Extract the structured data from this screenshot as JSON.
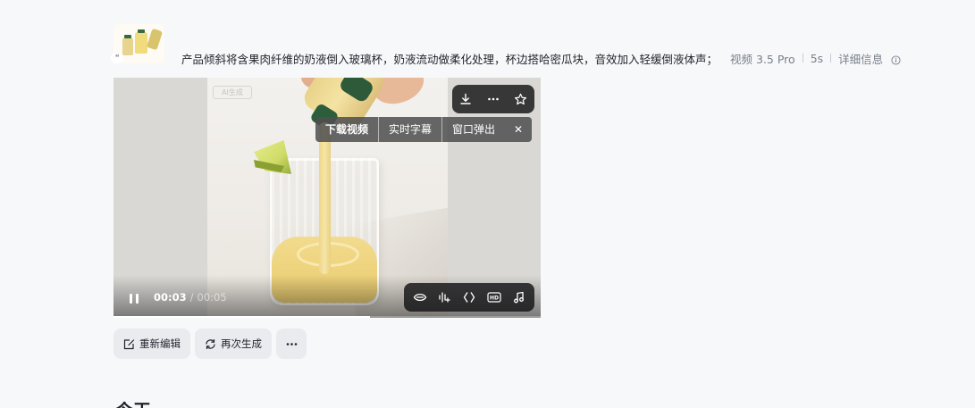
{
  "prompt": {
    "text": "产品倾斜将含果肉纤维的奶液倒入玻璃杯，奶液流动做柔化处理，杯边搭哈密瓜块，音效加入轻缓倒液体声；",
    "model": "视频 3.5 Pro",
    "duration": "5s",
    "details_label": "详细信息",
    "thumbnail_icon": "quote-icon"
  },
  "video": {
    "watermark": "AI生成",
    "current_time": "00:03",
    "separator": "/",
    "total_time": "00:05",
    "progress": 0.6,
    "top_toolbar": [
      "download-icon",
      "more-icon",
      "star-icon"
    ],
    "menu": {
      "items": [
        "下载视频",
        "实时字幕",
        "窗口弹出"
      ],
      "close": "✕"
    },
    "bottom_toolbar": [
      "lip-sync-icon",
      "audio-wave-icon",
      "frame-icon",
      "hd-icon",
      "music-icon"
    ]
  },
  "actions": {
    "reedit": "重新编辑",
    "regenerate": "再次生成",
    "more": "更多"
  },
  "section": {
    "heading": "今天"
  }
}
